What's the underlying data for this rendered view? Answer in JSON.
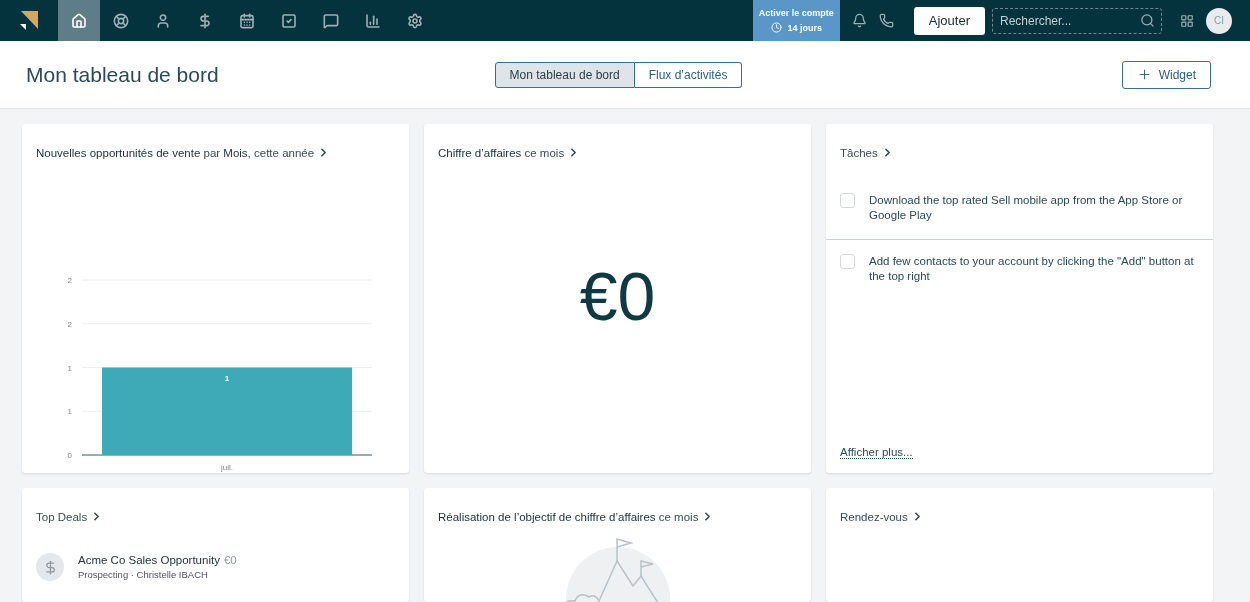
{
  "nav": {
    "items": [
      {
        "selected": true
      },
      {
        "selected": false
      },
      {
        "selected": false
      },
      {
        "selected": false
      },
      {
        "selected": false
      },
      {
        "selected": false
      },
      {
        "selected": false
      },
      {
        "selected": false
      },
      {
        "selected": false
      }
    ],
    "trial": {
      "title": "Activer le compte",
      "days": "14 jours"
    },
    "add_button": "Ajouter",
    "search": {
      "placeholder": "Rechercher..."
    },
    "avatar": "CI"
  },
  "header": {
    "title": "Mon tableau de bord",
    "tabs": [
      {
        "label": "Mon tableau de bord",
        "selected": true
      },
      {
        "label": "Flux d’activités",
        "selected": false
      }
    ],
    "widget_button": "Widget"
  },
  "widgets": [
    {
      "kind": "chart",
      "title": "**Nouvelles opportunités de vente** par **Mois**, cette année",
      "chart_data": {
        "type": "bar",
        "categories": [
          "juil."
        ],
        "values": [
          1
        ],
        "ylim": [
          0,
          2
        ],
        "yticks": [
          {
            "value": 0,
            "label": "0"
          },
          {
            "value": 0.5,
            "label": "1"
          },
          {
            "value": 1,
            "label": "1"
          },
          {
            "value": 1.5,
            "label": "2"
          },
          {
            "value": 2,
            "label": "2"
          }
        ],
        "data_labels": true,
        "grid": true
      }
    },
    {
      "kind": "amount",
      "title": "**Chiffre d’affaires** ce mois",
      "amount": "€0"
    },
    {
      "kind": "tasks",
      "title": "Tâches",
      "tasks": [
        {
          "text": "Download the top rated Sell mobile app from the App Store or Google Play",
          "checked": false
        },
        {
          "text": "Add few contacts to your account by clicking the \"Add\" button at the top right",
          "checked": false
        }
      ],
      "more": "Afficher plus..."
    },
    {
      "kind": "deals",
      "title": "Top Deals",
      "deals": [
        {
          "name": "Acme Co Sales Opportunity",
          "value": "€0",
          "stage": "Prospecting · Christelle IBACH"
        }
      ]
    },
    {
      "kind": "goal",
      "title": "**Réalisation de l’objectif de chiffre d’affaires** ce mois"
    },
    {
      "kind": "empty",
      "title": "Rendez-vous"
    }
  ]
}
